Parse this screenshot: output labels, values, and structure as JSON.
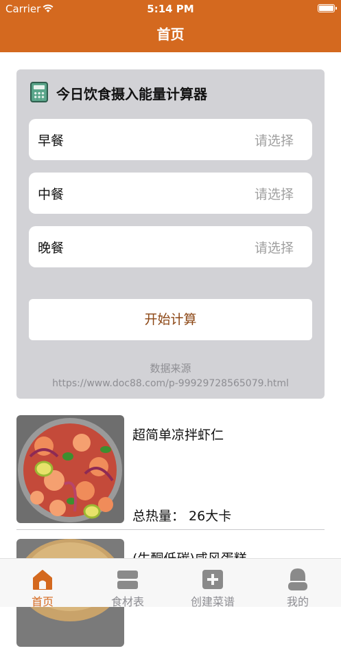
{
  "status_bar": {
    "carrier": "Carrier",
    "time": "5:14 PM"
  },
  "nav": {
    "title": "首页"
  },
  "calculator": {
    "title": "今日饮食摄入能量计算器",
    "meals": [
      {
        "label": "早餐",
        "placeholder": "请选择"
      },
      {
        "label": "中餐",
        "placeholder": "请选择"
      },
      {
        "label": "晚餐",
        "placeholder": "请选择"
      }
    ],
    "start_label": "开始计算",
    "source_label": "数据来源",
    "source_url": "https://www.doc88.com/p-99929728565079.html"
  },
  "recipes": [
    {
      "name": "超简单凉拌虾仁",
      "calories": "总热量：  26大卡"
    },
    {
      "name": "(生酮低碳)咸风蛋糕",
      "calories": ""
    }
  ],
  "tabs": [
    {
      "label": "首页",
      "icon": "home-icon",
      "active": true
    },
    {
      "label": "食材表",
      "icon": "list-icon",
      "active": false
    },
    {
      "label": "创建菜谱",
      "icon": "add-icon",
      "active": false
    },
    {
      "label": "我的",
      "icon": "user-icon",
      "active": false
    }
  ],
  "colors": {
    "accent": "#d4691f",
    "card": "#d2d2d6",
    "button_text": "#8b4513"
  }
}
